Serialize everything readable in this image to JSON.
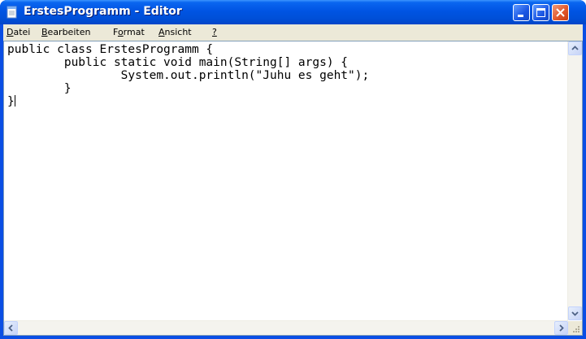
{
  "window": {
    "title": "ErstesProgramm - Editor"
  },
  "menu": [
    {
      "label": "Datei",
      "accel": "D",
      "rest": "atei"
    },
    {
      "label": "Bearbeiten",
      "accel": "B",
      "rest": "earbeiten"
    },
    {
      "label": "Format",
      "pre": "F",
      "accel": "o",
      "rest": "rmat"
    },
    {
      "label": "Ansicht",
      "accel": "A",
      "rest": "nsicht"
    },
    {
      "label": "?",
      "accel": "?",
      "rest": ""
    }
  ],
  "editor": {
    "text": "public class ErstesProgramm {\n        public static void main(String[] args) {\n                System.out.println(\"Juhu es geht\");\n        }\n}"
  },
  "icons": {
    "app": "notepad-icon",
    "minimize": "minimize-icon",
    "maximize": "maximize-icon",
    "close": "close-icon"
  },
  "colors": {
    "titlebar": "#0054e3",
    "close_button": "#e2582c",
    "frame": "#ece9d8"
  }
}
